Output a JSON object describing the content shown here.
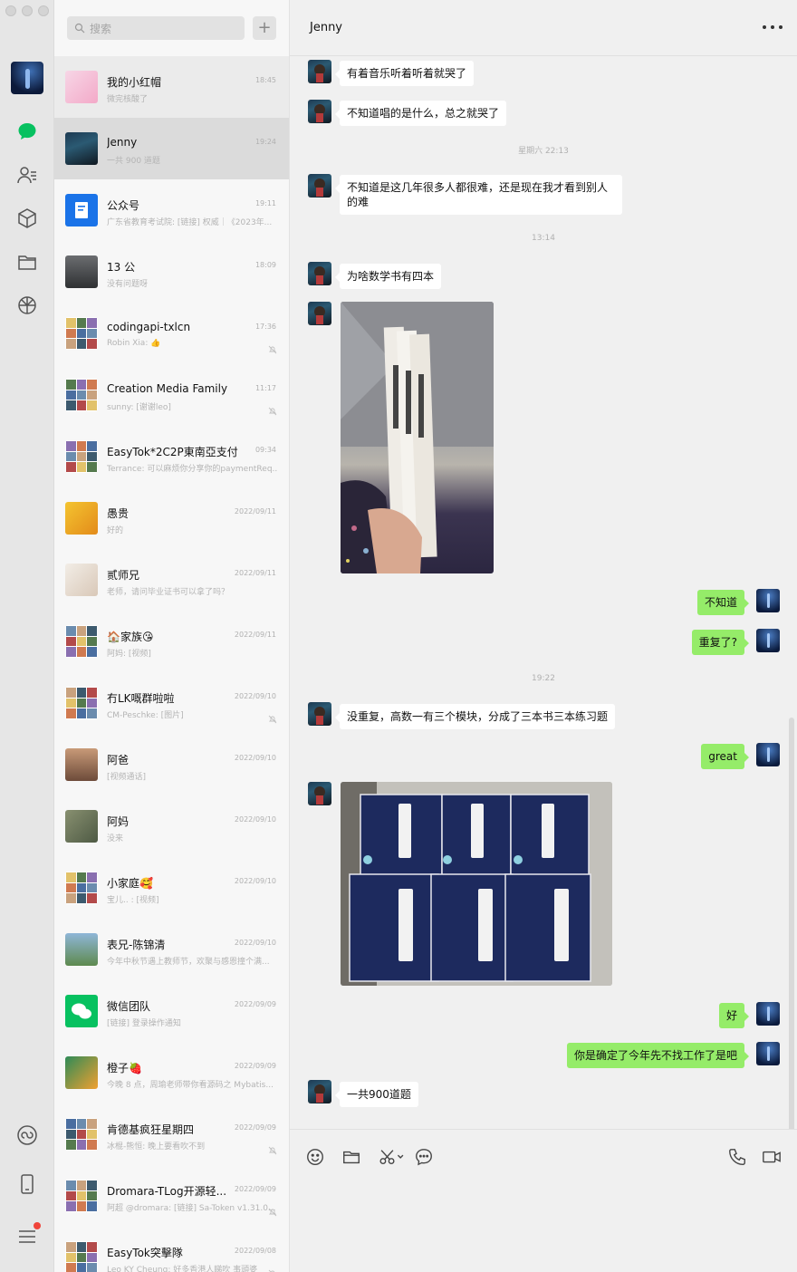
{
  "search": {
    "placeholder": "搜索",
    "add": "+"
  },
  "chat_list": [
    {
      "name": "我的小红帽",
      "time": "18:45",
      "preview": "微完核酸了",
      "muted": false
    },
    {
      "name": "Jenny",
      "time": "19:24",
      "preview": "一共 900 道题",
      "muted": false
    },
    {
      "name": "公众号",
      "time": "19:11",
      "preview": "广东省教育考试院: [链接] 权威｜《2023年...",
      "muted": false
    },
    {
      "name": "13 公",
      "time": "18:09",
      "preview": "没有问题呀",
      "muted": false
    },
    {
      "name": "codingapi-txlcn",
      "time": "17:36",
      "preview": "Robin Xia: 👍",
      "muted": true
    },
    {
      "name": "Creation Media Family",
      "time": "11:17",
      "preview": "sunny: [谢谢leo]",
      "muted": true
    },
    {
      "name": "EasyTok*2C2P東南亞支付",
      "time": "09:34",
      "preview": "Terrance: 可以麻烦你分享你的paymentReq...",
      "muted": false
    },
    {
      "name": "愚贵",
      "time": "2022/09/11",
      "preview": "好的",
      "muted": false
    },
    {
      "name": "贰师兄",
      "time": "2022/09/11",
      "preview": "老师，请问毕业证书可以拿了吗？",
      "muted": false
    },
    {
      "name": "🏠家族😘",
      "time": "2022/09/11",
      "preview": "阿妈: [视频]",
      "muted": false
    },
    {
      "name": "冇LK嘅群啦啦",
      "time": "2022/09/10",
      "preview": "CM-Peschke: [图片]",
      "muted": true
    },
    {
      "name": "阿爸",
      "time": "2022/09/10",
      "preview": "[视频通话]",
      "muted": false
    },
    {
      "name": "阿妈",
      "time": "2022/09/10",
      "preview": "没来",
      "muted": false
    },
    {
      "name": "小家庭🥰",
      "time": "2022/09/10",
      "preview": "宝儿.. : [视频]",
      "muted": false
    },
    {
      "name": "表兄-陈锦清",
      "time": "2022/09/10",
      "preview": "今年中秋节遇上教师节，欢聚与感恩撞个满...",
      "muted": false
    },
    {
      "name": "微信团队",
      "time": "2022/09/09",
      "preview": "[链接] 登录操作通知",
      "muted": false
    },
    {
      "name": "橙子🍓",
      "time": "2022/09/09",
      "preview": "今晚 8 点，周瑜老师带你看源码之 Mybatis...",
      "muted": false
    },
    {
      "name": "肯德基疯狂星期四",
      "time": "2022/09/09",
      "preview": "冰棍-熊恒: 晚上要看吹不到",
      "muted": true
    },
    {
      "name": "Dromara-TLog开源轻...",
      "time": "2022/09/09",
      "preview": "阿超 @dromara: [链接] Sa-Token v1.31.0...",
      "muted": true
    },
    {
      "name": "EasyTok突擊隊",
      "time": "2022/09/08",
      "preview": "Leo KY Cheung: 好多香港人睇吹 事頭婆",
      "muted": true
    }
  ],
  "conversation": {
    "title": "Jenny",
    "more_icon": "more-icon",
    "messages": [
      {
        "from": "them",
        "type": "text",
        "text": "有着音乐听着听着就哭了"
      },
      {
        "from": "them",
        "type": "text",
        "text": "不知道唱的是什么，总之就哭了"
      },
      {
        "type": "time",
        "text": "星期六 22:13"
      },
      {
        "from": "them",
        "type": "text",
        "text": "不知道是这几年很多人都很难，还是现在我才看到别人的难"
      },
      {
        "type": "time",
        "text": "13:14"
      },
      {
        "from": "them",
        "type": "text",
        "text": "为啥数学书有四本"
      },
      {
        "from": "them",
        "type": "image",
        "alt": "books-photo-1"
      },
      {
        "from": "me",
        "type": "text",
        "text": "不知道"
      },
      {
        "from": "me",
        "type": "text",
        "text": "重复了?"
      },
      {
        "type": "time",
        "text": "19:22"
      },
      {
        "from": "them",
        "type": "text",
        "text": "没重复，高数一有三个模块，分成了三本书三本练习题"
      },
      {
        "from": "me",
        "type": "text",
        "text": "great"
      },
      {
        "from": "them",
        "type": "image",
        "alt": "books-photo-2"
      },
      {
        "from": "me",
        "type": "text",
        "text": "好"
      },
      {
        "from": "me",
        "type": "text",
        "text": "你是确定了今年先不找工作了是吧"
      },
      {
        "from": "them",
        "type": "text",
        "text": "一共900道题"
      }
    ]
  },
  "toolbar": [
    "emoji-icon",
    "folder-icon",
    "scissors-icon",
    "chat-bubble-icon",
    "phone-icon",
    "video-icon"
  ],
  "colors": {
    "bubble_out": "#95ec69",
    "bubble_in": "#ffffff",
    "accent": "#07c160"
  }
}
